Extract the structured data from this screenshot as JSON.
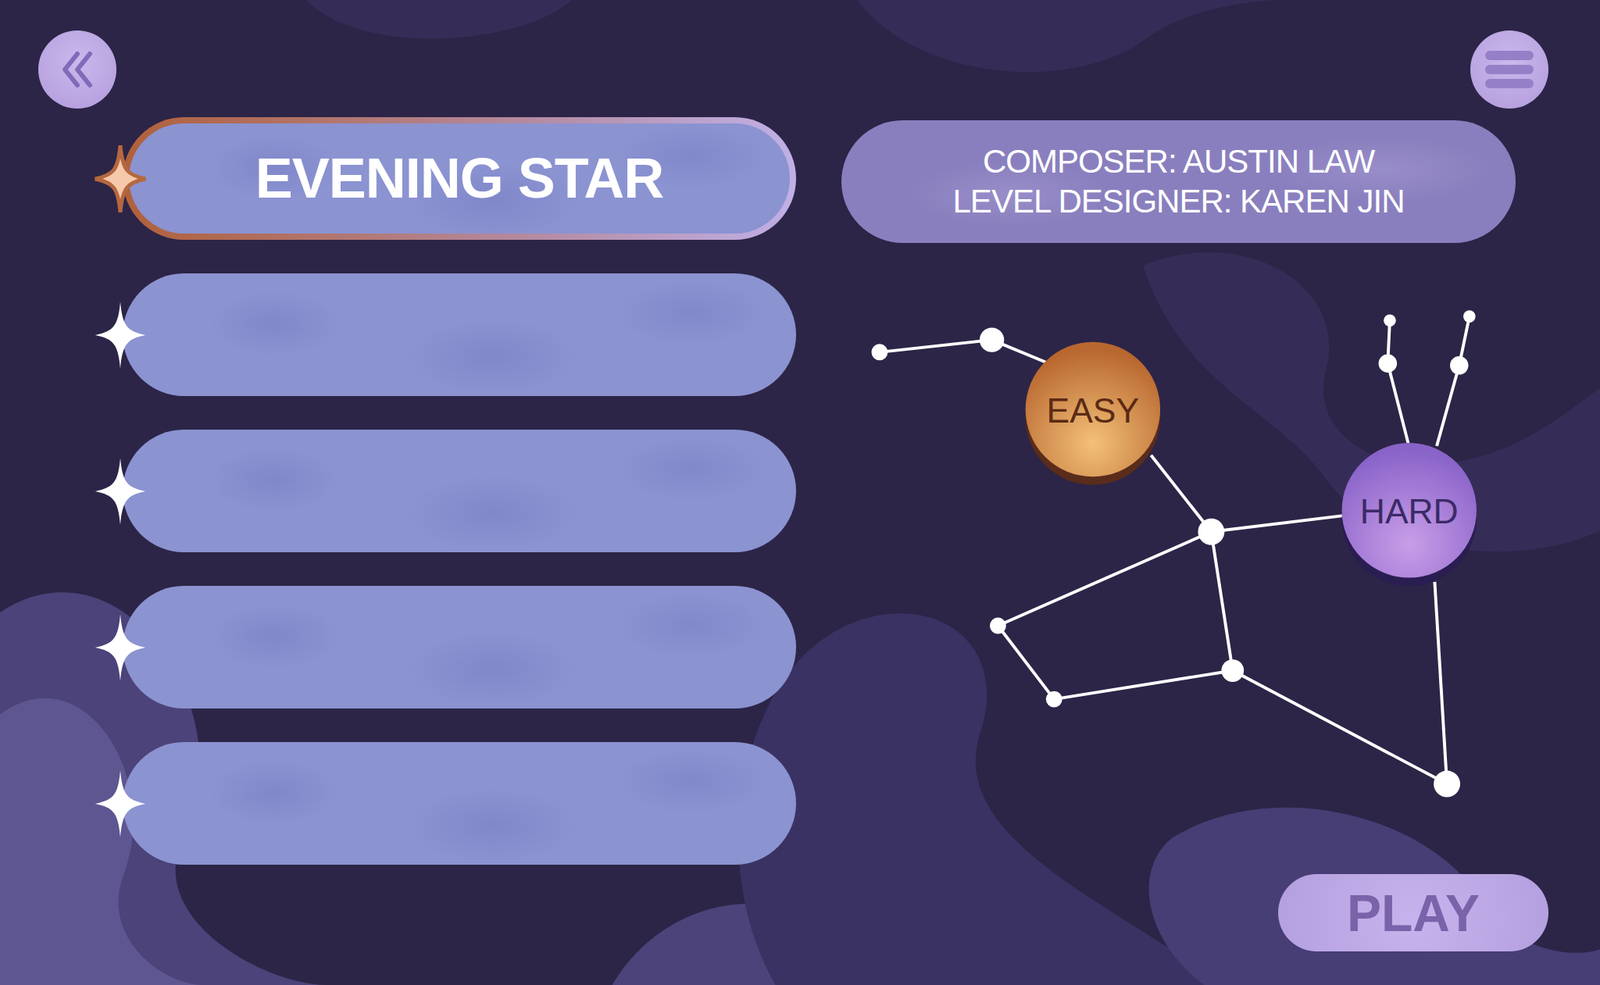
{
  "songs": [
    {
      "title": "EVENING STAR",
      "selected": true
    },
    {
      "title": "",
      "selected": false
    },
    {
      "title": "",
      "selected": false
    },
    {
      "title": "",
      "selected": false
    },
    {
      "title": "",
      "selected": false
    }
  ],
  "credits": [
    "COMPOSER: AUSTIN LAW",
    "LEVEL DESIGNER: KAREN JIN"
  ],
  "difficulties": [
    {
      "label": "EASY",
      "selected": true
    },
    {
      "label": "HARD",
      "selected": false
    }
  ],
  "play_button": "PLAY"
}
